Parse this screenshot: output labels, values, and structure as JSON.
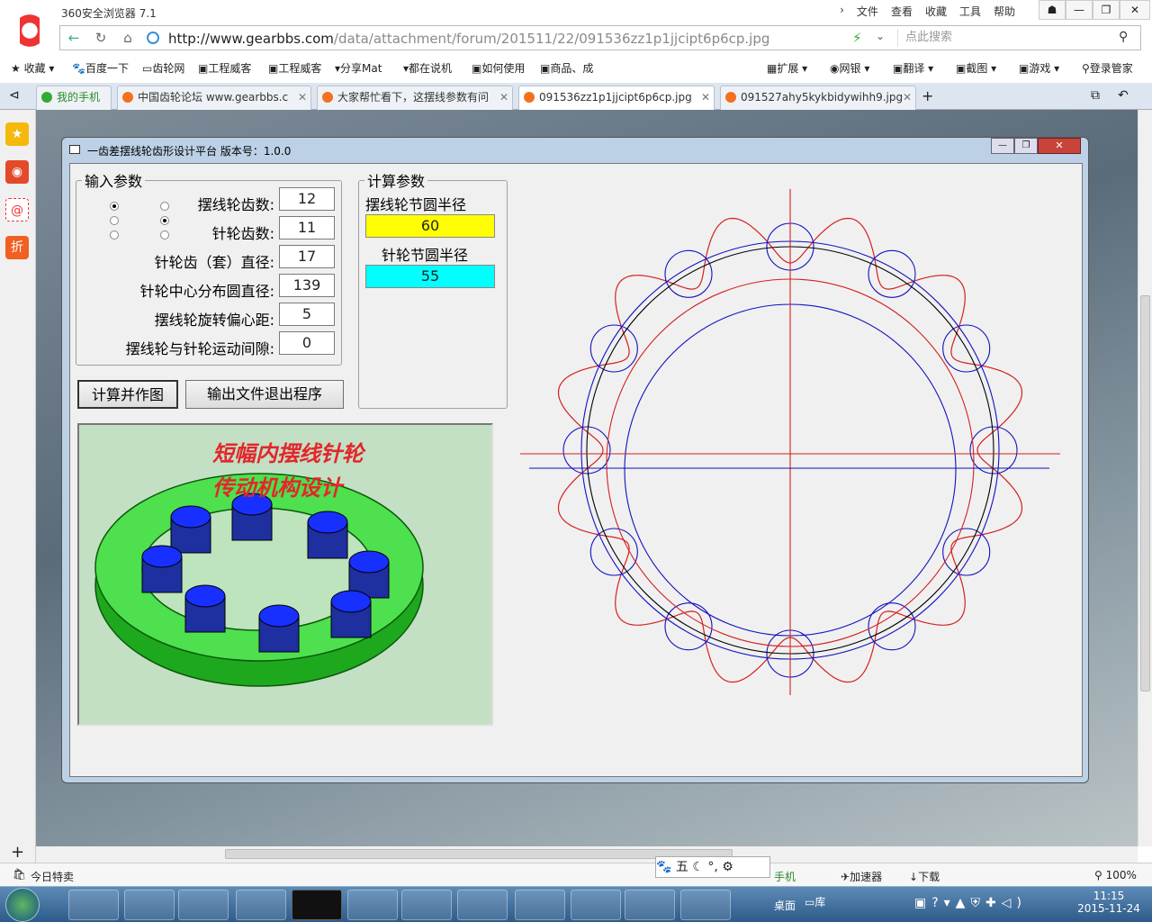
{
  "browser": {
    "title": "360安全浏览器 7.1",
    "menus": [
      "文件",
      "查看",
      "收藏",
      "工具",
      "帮助"
    ],
    "window_buttons": [
      "☗",
      "—",
      "❐",
      "✕"
    ],
    "url_host": "http://www.gearbbs.com",
    "url_path": "/data/attachment/forum/201511/22/091536zz1p1jjcipt6p6cp.jpg",
    "search_placeholder": "点此搜索"
  },
  "bookmarks": {
    "left": [
      "收藏",
      "百度一下",
      "齿轮网",
      "工程威客",
      "工程威客",
      "分享Mat",
      "都在说机",
      "如何使用",
      "商品、成"
    ],
    "right": [
      "扩展",
      "网银",
      "翻译",
      "截图",
      "游戏",
      "登录管家"
    ]
  },
  "tabs": [
    {
      "label": "我的手机",
      "active": false
    },
    {
      "label": "中国齿轮论坛 www.gearbbs.c",
      "active": false
    },
    {
      "label": "大家帮忙看下，这摆线参数有问",
      "active": false
    },
    {
      "label": "091536zz1p1jjcipt6p6cp.jpg",
      "active": true
    },
    {
      "label": "091527ahy5kykbidywihh9.jpg",
      "active": false
    }
  ],
  "dialog": {
    "title": "一齿差摆线轮齿形设计平台  版本号：1.0.0",
    "input_group": "输入参数",
    "fields": [
      {
        "label": "摆线轮齿数:",
        "value": "12"
      },
      {
        "label": "针轮齿数:",
        "value": "11"
      },
      {
        "label": "针轮齿（套）直径:",
        "value": "17"
      },
      {
        "label": "针轮中心分布圆直径:",
        "value": "139"
      },
      {
        "label": "摆线轮旋转偏心距:",
        "value": "5"
      },
      {
        "label": "摆线轮与针轮运动间隙:",
        "value": "0"
      }
    ],
    "calc_button": "计算并作图",
    "exit_button": "输出文件退出程序",
    "calc_group": "计算参数",
    "cycloid_pitch_label": "摆线轮节圆半径",
    "cycloid_pitch_value": "60",
    "pin_pitch_label": "针轮节圆半径",
    "pin_pitch_value": "55",
    "image_title_line1": "短幅内摆线针轮",
    "image_title_line2": "传动机构设计"
  },
  "colors": {
    "cycloid_value_bg": "#ffff00",
    "pin_value_bg": "#00ffff",
    "curve_red": "#d42020",
    "curve_blue": "#1010c0"
  },
  "statusbar": {
    "left": "今日特卖",
    "ime": [
      "五"
    ],
    "items": [
      "手机",
      "加速器",
      "下载"
    ],
    "zoom": "100%"
  },
  "taskbar": {
    "desktop": "桌面",
    "library": "库",
    "time": "11:15",
    "date": "2015-11-24"
  }
}
